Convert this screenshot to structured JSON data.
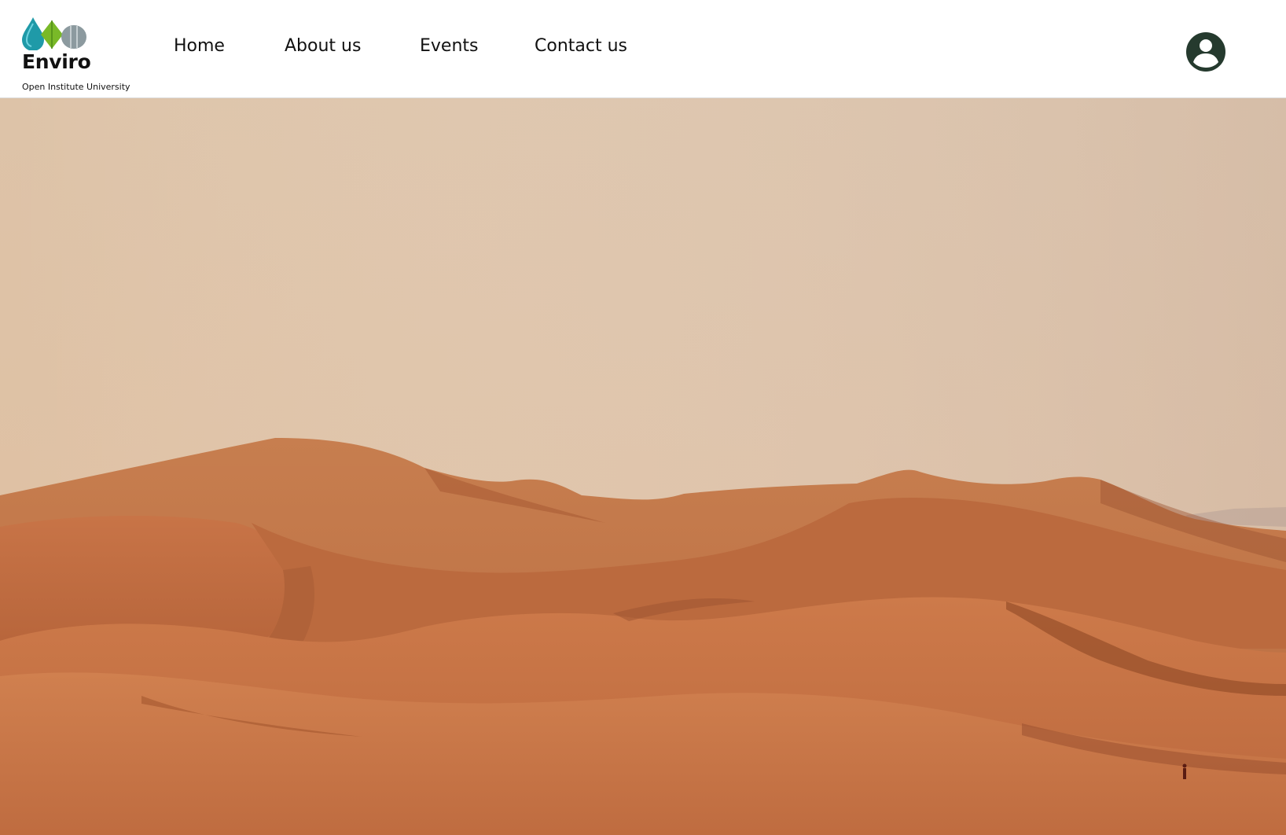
{
  "brand": {
    "name": "Enviro",
    "subtitle": "Open Institute University",
    "logo_icon": "water-leaf-stone-logo",
    "colors": {
      "water": "#1f9aa8",
      "leaf": "#79b928",
      "stone": "#8c9a9f"
    }
  },
  "nav": {
    "items": [
      {
        "label": "Home"
      },
      {
        "label": "About us"
      },
      {
        "label": "Events"
      },
      {
        "label": "Contact us"
      }
    ]
  },
  "account": {
    "icon": "user-account-icon",
    "color": "#253a2e"
  },
  "hero": {
    "image": "desert-dunes-photo",
    "colors": {
      "sky": "#dfc3a8",
      "sand": "#c06a3e",
      "shadow": "#8e4725"
    }
  }
}
